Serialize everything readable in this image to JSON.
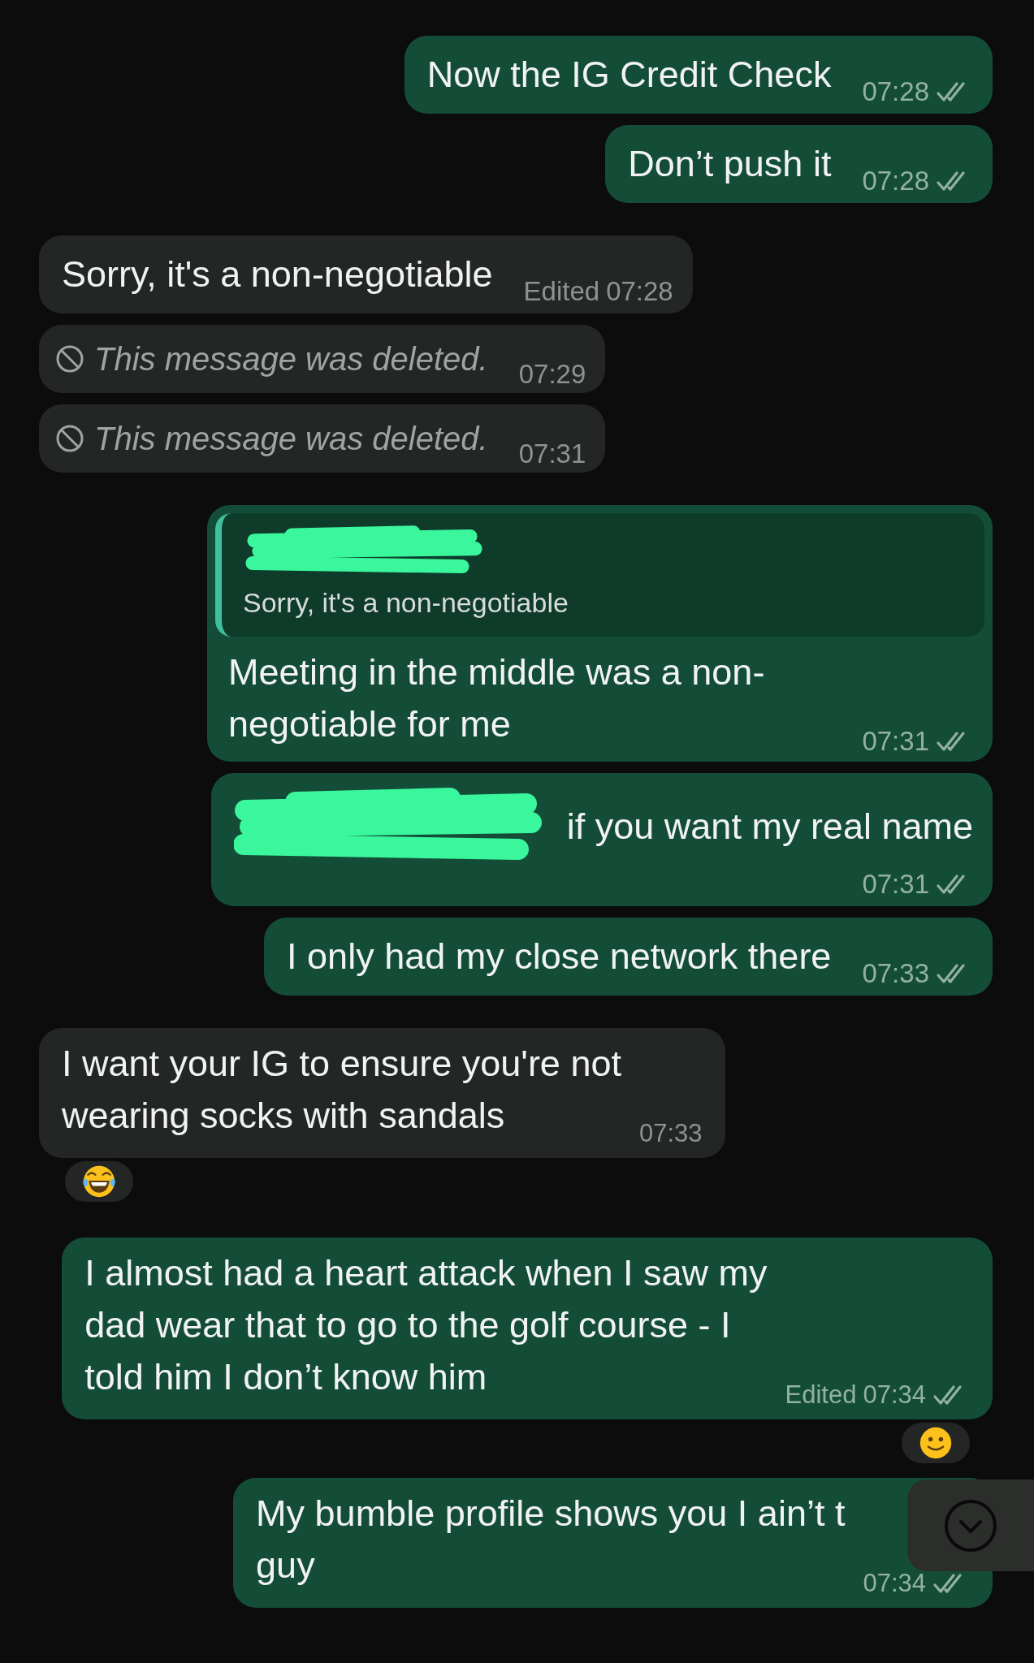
{
  "messages": [
    {
      "outgoing": true,
      "kind": "text",
      "lines": [
        "Now the IG Credit Check"
      ],
      "time": "07:28",
      "delivered": true
    },
    {
      "outgoing": true,
      "kind": "text",
      "lines": [
        "Don’t push it"
      ],
      "time": "07:28",
      "delivered": true
    },
    {
      "outgoing": false,
      "kind": "text",
      "lines": [
        "Sorry, it's a non-negotiable"
      ],
      "edited_label": "Edited",
      "time": "07:28"
    },
    {
      "outgoing": false,
      "kind": "deleted",
      "lines": [
        "This message was deleted."
      ],
      "time": "07:29"
    },
    {
      "outgoing": false,
      "kind": "deleted",
      "lines": [
        "This message was deleted."
      ],
      "time": "07:31"
    },
    {
      "outgoing": true,
      "kind": "reply",
      "quote": {
        "author_redacted": true,
        "text": "Sorry, it's a non-negotiable"
      },
      "lines": [
        "Meeting in the middle was a non-",
        "negotiable for me"
      ],
      "time": "07:31",
      "delivered": true
    },
    {
      "outgoing": true,
      "kind": "text",
      "redacted_prefix": true,
      "lines": [
        "if you want my real name"
      ],
      "time": "07:31",
      "delivered": true
    },
    {
      "outgoing": true,
      "kind": "text",
      "lines": [
        "I only had my close network there"
      ],
      "time": "07:33",
      "delivered": true
    },
    {
      "outgoing": false,
      "kind": "text",
      "lines": [
        "I want your IG to ensure you're not",
        "wearing socks with sandals"
      ],
      "time": "07:33",
      "reaction": {
        "kind": "laughing"
      }
    },
    {
      "outgoing": true,
      "kind": "text",
      "lines": [
        "I almost had a heart attack when I saw my",
        "dad wear that to go to the golf course - I",
        "told him I don’t know him"
      ],
      "edited_label": "Edited",
      "time": "07:34",
      "delivered": true,
      "reaction": {
        "kind": "face"
      }
    },
    {
      "outgoing": true,
      "kind": "text",
      "lines": [
        "My bumble profile shows you I ain’t t",
        "guy"
      ],
      "time": "07:34",
      "delivered": true
    }
  ]
}
